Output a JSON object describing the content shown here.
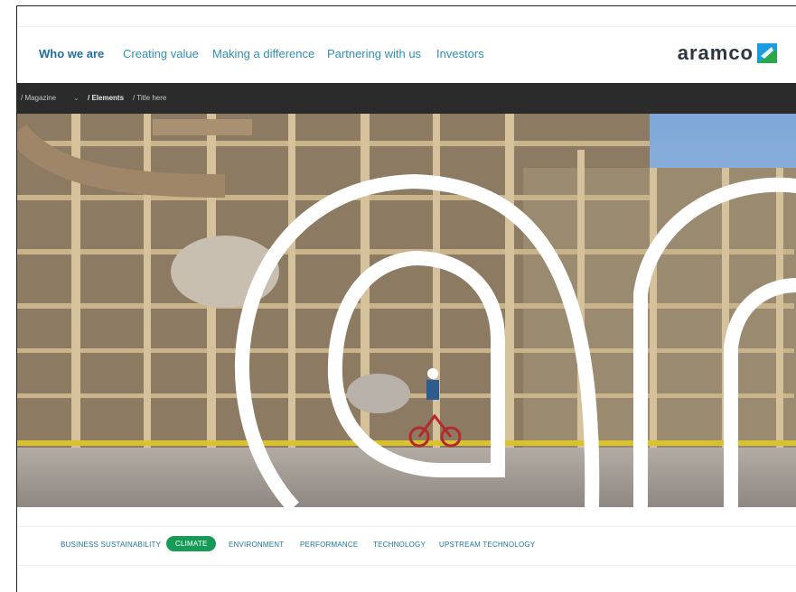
{
  "nav": {
    "items": [
      {
        "label": "Who we are",
        "active": true
      },
      {
        "label": "Creating value",
        "active": false
      },
      {
        "label": "Making a difference",
        "active": false
      },
      {
        "label": "Partnering with us",
        "active": false
      },
      {
        "label": "Investors",
        "active": false
      }
    ]
  },
  "logo": {
    "text": "aramco"
  },
  "breadcrumb": {
    "magazine": "/ Magazine",
    "elements": "/ Elements",
    "title": "/ Title here"
  },
  "tags": [
    {
      "label": "BUSINESS SUSTAINABILITY",
      "active": false
    },
    {
      "label": "CLIMATE",
      "active": true
    },
    {
      "label": "ENVIRONMENT",
      "active": false
    },
    {
      "label": "PERFORMANCE",
      "active": false
    },
    {
      "label": "TECHNOLOGY",
      "active": false
    },
    {
      "label": "UPSTREAM TECHNOLOGY",
      "active": false
    }
  ],
  "colors": {
    "accent": "#2f8fb6",
    "tag_active": "#179a56",
    "breadcrumb_bg": "#2b2b2b"
  }
}
